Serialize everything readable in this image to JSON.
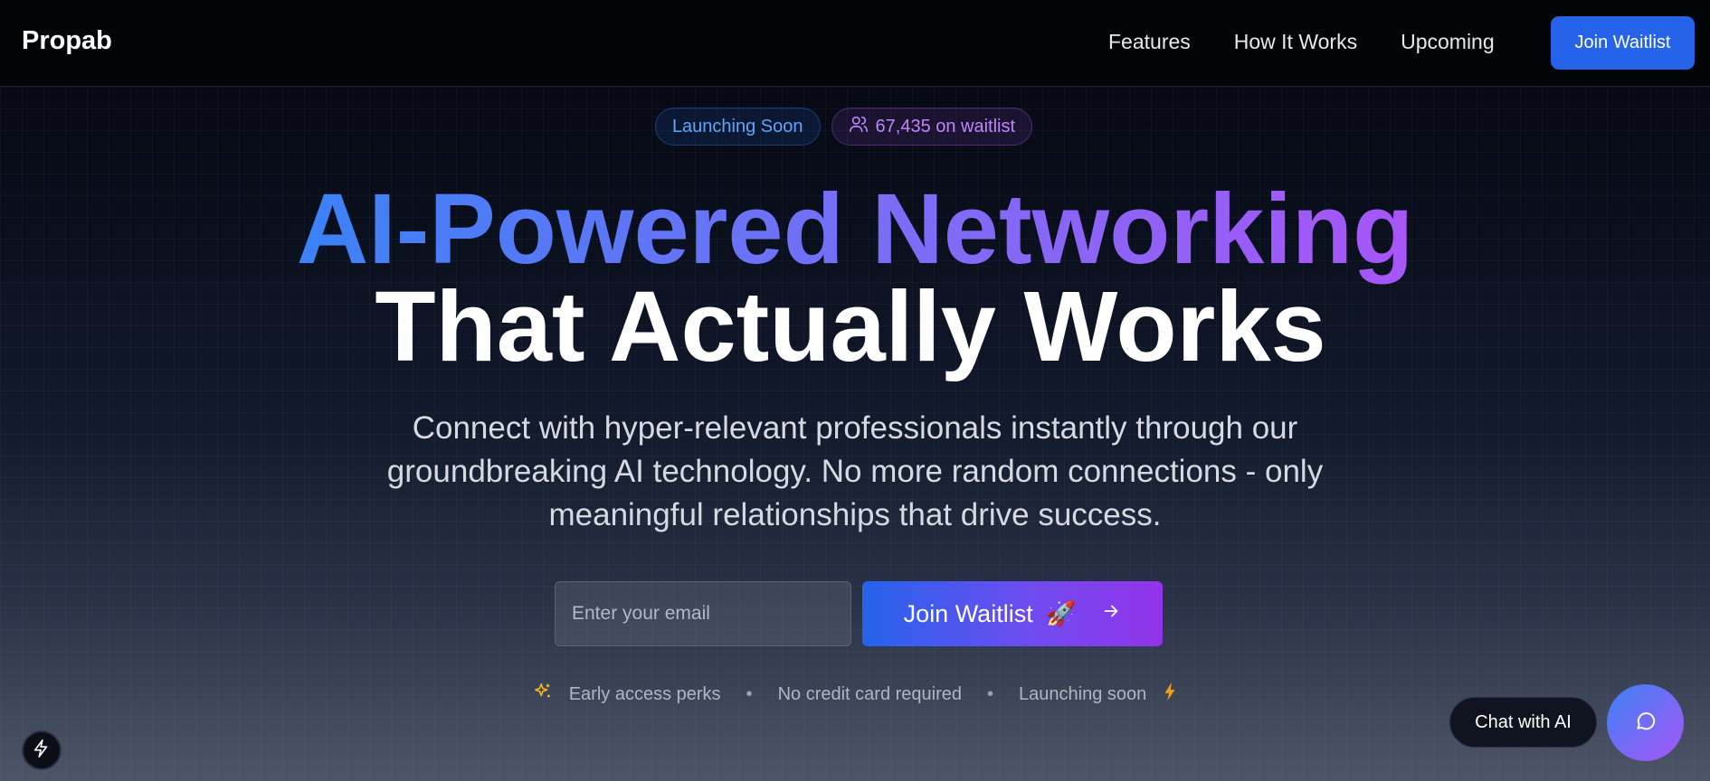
{
  "nav": {
    "brand": "Propab",
    "links": [
      "Features",
      "How It Works",
      "Upcoming"
    ],
    "cta_label": "Join Waitlist"
  },
  "hero": {
    "badge_launch": "Launching Soon",
    "badge_waitlist": "67,435 on waitlist",
    "headline_line1": "AI-Powered Networking",
    "headline_line2": "That Actually Works",
    "subtitle": "Connect with hyper-relevant professionals instantly through our groundbreaking AI technology. No more random connections - only meaningful relationships that drive success.",
    "email_placeholder": "Enter your email",
    "join_button_label": "Join Waitlist",
    "join_button_emoji": "🚀",
    "perks": [
      "Early access perks",
      "No credit card required",
      "Launching soon"
    ]
  },
  "chat": {
    "label": "Chat with AI"
  },
  "icons": {
    "users": "users-icon",
    "arrow": "arrow-right-icon",
    "sparkles": "sparkles-icon",
    "bolt": "bolt-icon",
    "chat": "chat-bubble-icon"
  },
  "colors": {
    "accent_blue": "#2563eb",
    "accent_purple": "#a855f7",
    "background": "#05070d"
  }
}
